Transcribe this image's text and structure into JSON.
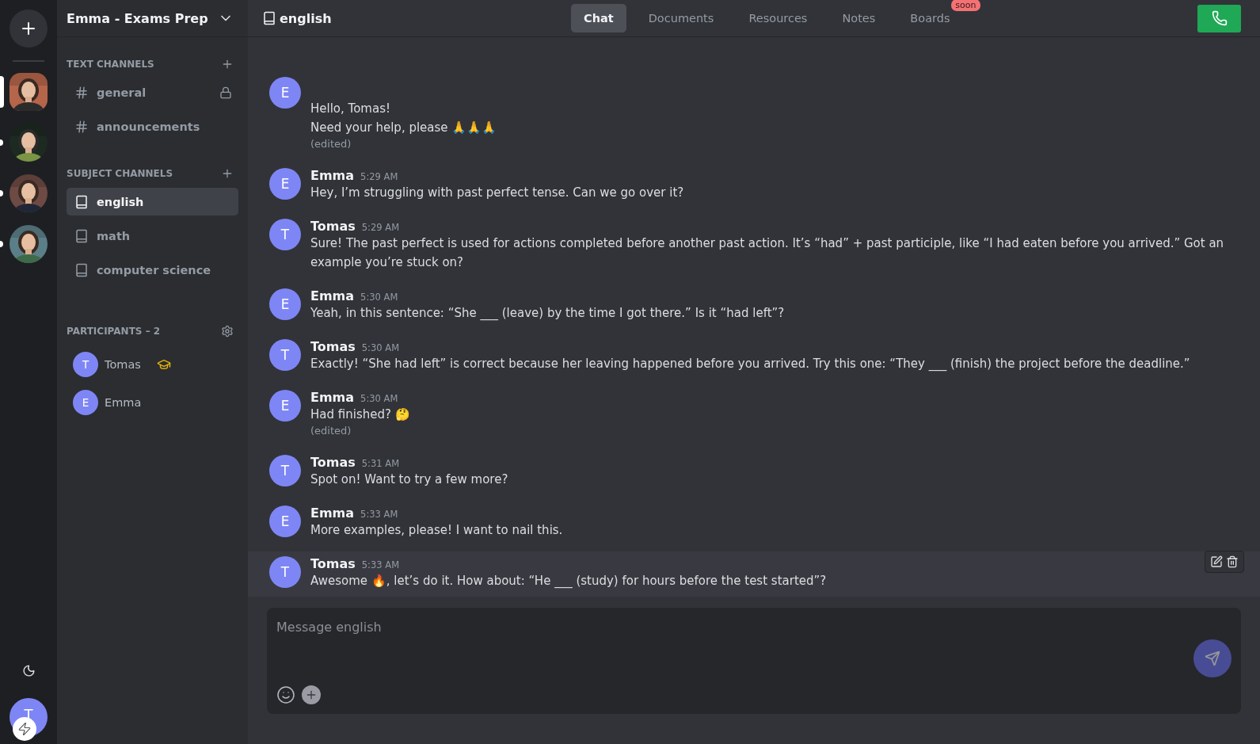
{
  "servers": [
    {
      "selected": true
    },
    {
      "selected": false,
      "unread": true
    },
    {
      "selected": false,
      "unread": true
    },
    {
      "selected": false,
      "unread": true
    }
  ],
  "user_avatar": {
    "initial": "T"
  },
  "workspace": {
    "title": "Emma - Exams Prep"
  },
  "sections": [
    {
      "title": "TEXT CHANNELS",
      "channels": [
        {
          "kind": "text",
          "name": "general",
          "locked": true,
          "selected": false
        },
        {
          "kind": "text",
          "name": "announcements",
          "locked": false,
          "selected": false
        }
      ]
    },
    {
      "title": "SUBJECT CHANNELS",
      "channels": [
        {
          "kind": "subject",
          "name": "english",
          "locked": false,
          "selected": true
        },
        {
          "kind": "subject",
          "name": "math",
          "locked": false,
          "selected": false
        },
        {
          "kind": "subject",
          "name": "computer science",
          "locked": false,
          "selected": false
        }
      ]
    }
  ],
  "participants": {
    "title": "PARTICIPANTS – 2",
    "members": [
      {
        "initial": "T",
        "name": "Tomas",
        "tutor": true
      },
      {
        "initial": "E",
        "name": "Emma",
        "tutor": false
      }
    ]
  },
  "channel": {
    "name": "english"
  },
  "tabs": [
    {
      "label": "Chat",
      "selected": true
    },
    {
      "label": "Documents",
      "selected": false
    },
    {
      "label": "Resources",
      "selected": false
    },
    {
      "label": "Notes",
      "selected": false
    },
    {
      "label": "Boards",
      "selected": false,
      "badge": "soon"
    }
  ],
  "messages": [
    {
      "initial": "E",
      "lines": [
        "Hello, Tomas!",
        "Need your help, please 🙏🙏🙏"
      ],
      "edited": "(edited)",
      "hovered": false
    },
    {
      "initial": "E",
      "author": "Emma",
      "time": "5:29 AM",
      "lines": [
        "Hey, I’m struggling with past perfect tense. Can we go over it?"
      ],
      "hovered": false
    },
    {
      "initial": "T",
      "author": "Tomas",
      "time": "5:29 AM",
      "lines": [
        "Sure! The past perfect is used for actions completed before another past action. It’s “had” + past participle, like “I had eaten before you arrived.” Got an example you’re stuck on?"
      ],
      "hovered": false
    },
    {
      "initial": "E",
      "author": "Emma",
      "time": "5:30 AM",
      "lines": [
        "Yeah, in this sentence: “She ___ (leave) by the time I got there.” Is it “had left”?"
      ],
      "hovered": false
    },
    {
      "initial": "T",
      "author": "Tomas",
      "time": "5:30 AM",
      "lines": [
        "Exactly! “She had left” is correct because her leaving happened before you arrived. Try this one: “They ___ (finish) the project before the deadline.”"
      ],
      "hovered": false
    },
    {
      "initial": "E",
      "author": "Emma",
      "time": "5:30 AM",
      "lines": [
        "Had finished? 🤔"
      ],
      "edited": "(edited)",
      "hovered": false
    },
    {
      "initial": "T",
      "author": "Tomas",
      "time": "5:31 AM",
      "lines": [
        "Spot on! Want to try a few more?"
      ],
      "hovered": false
    },
    {
      "initial": "E",
      "author": "Emma",
      "time": "5:33 AM",
      "lines": [
        "More examples, please! I want to nail this."
      ],
      "hovered": false
    },
    {
      "initial": "T",
      "author": "Tomas",
      "time": "5:33 AM",
      "lines": [
        "Awesome 🔥, let’s do it. How about: “He ___ (study) for hours before the test started”?"
      ],
      "hovered": true
    }
  ],
  "composer": {
    "placeholder": "Message english"
  }
}
